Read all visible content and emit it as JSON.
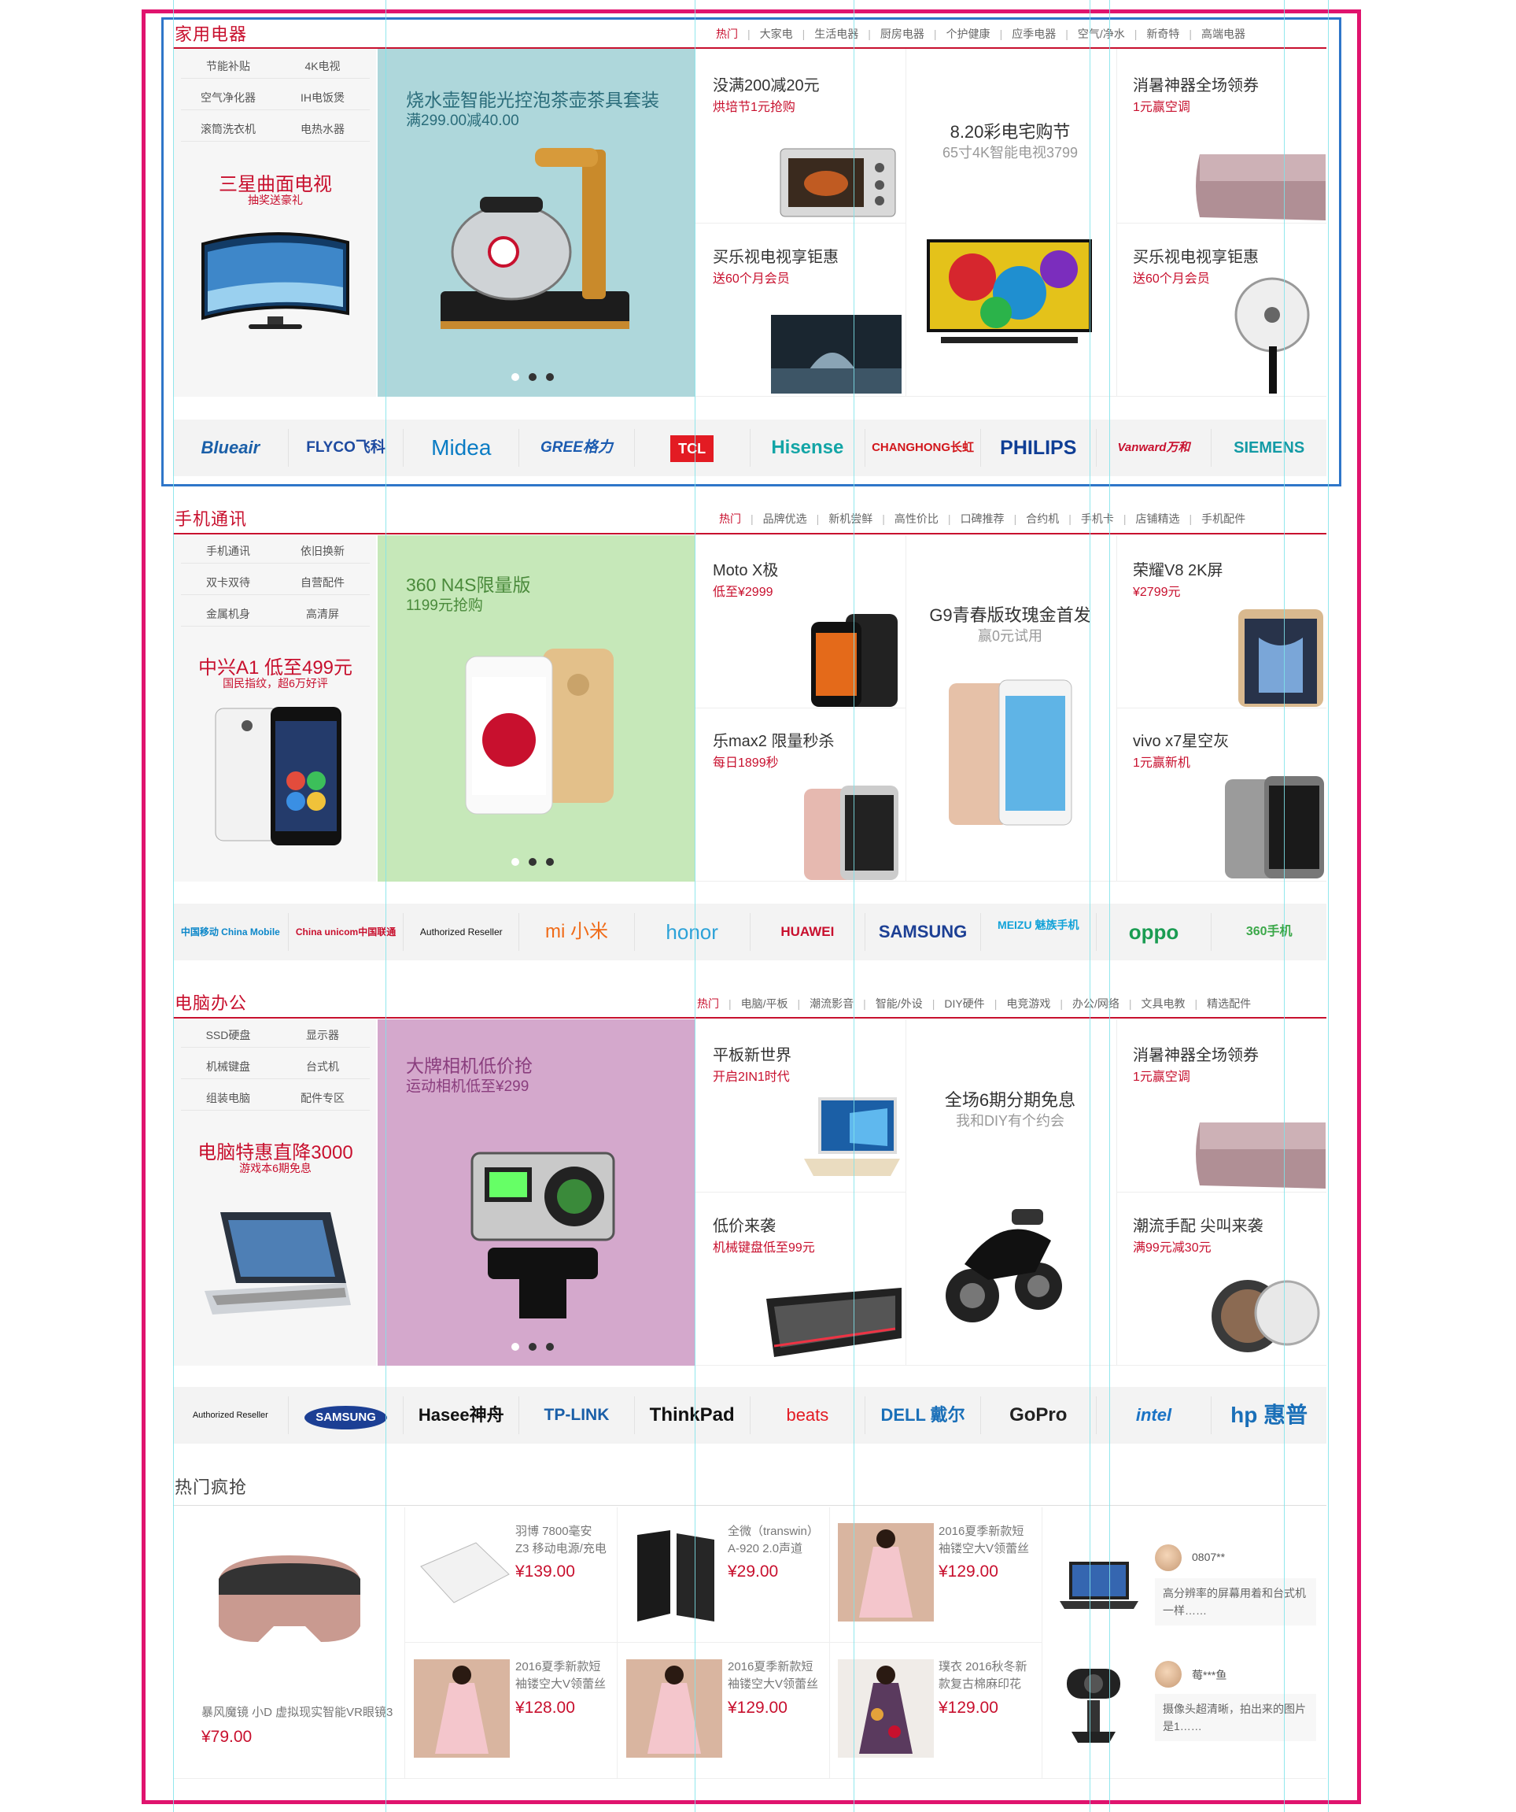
{
  "sections": [
    {
      "title": "家用电器",
      "nav": [
        "热门",
        "大家电",
        "生活电器",
        "厨房电器",
        "个护健康",
        "应季电器",
        "空气/净水",
        "新奇特",
        "高端电器"
      ],
      "tags": [
        "节能补贴",
        "4K电视",
        "空气净化器",
        "IH电饭煲",
        "滚筒洗衣机",
        "电热水器"
      ],
      "left_title": "三星曲面电视",
      "left_sub": "抽奖送豪礼",
      "banner_title": "烧水壶智能光控泡茶壶茶具套装",
      "banner_sub": "满299.00减40.00",
      "cells": [
        {
          "title": "没满200减20元",
          "sub": "烘培节1元抢购"
        },
        {
          "title": "8.20彩电宅购节",
          "sub": "65寸4K智能电视3799"
        },
        {
          "title": "消暑神器全场领券",
          "sub": "1元赢空调"
        },
        {
          "title": "买乐视电视享钜惠",
          "sub": "送60个月会员"
        },
        {
          "title": "买乐视电视享钜惠",
          "sub": "送60个月会员"
        }
      ],
      "brands": [
        "Blueair",
        "FLYCO飞科",
        "Midea",
        "GREE格力",
        "TCL",
        "Hisense",
        "CHANGHONG长虹",
        "PHILIPS",
        "Vanward万和",
        "SIEMENS"
      ]
    },
    {
      "title": "手机通讯",
      "nav": [
        "热门",
        "品牌优选",
        "新机尝鲜",
        "高性价比",
        "口碑推荐",
        "合约机",
        "手机卡",
        "店铺精选",
        "手机配件"
      ],
      "tags": [
        "手机通讯",
        "依旧换新",
        "双卡双待",
        "自营配件",
        "金属机身",
        "高清屏"
      ],
      "left_title": "中兴A1 低至499元",
      "left_sub": "国民指纹，超6万好评",
      "banner_title": "360 N4S限量版",
      "banner_sub": "1199元抢购",
      "cells": [
        {
          "title": "Moto X极",
          "sub": "低至¥2999"
        },
        {
          "title": "G9青春版玫瑰金首发",
          "sub": "赢0元试用"
        },
        {
          "title": "荣耀V8 2K屏",
          "sub": "¥2799元"
        },
        {
          "title": "乐max2 限量秒杀",
          "sub": "每日1899秒"
        },
        {
          "title": "vivo x7星空灰",
          "sub": "1元赢新机"
        }
      ],
      "brands": [
        "中国移动 China Mobile",
        "China unicom中国联通",
        "Authorized Reseller",
        "mi 小米",
        "honor",
        "HUAWEI",
        "SAMSUNG",
        "MEIZU 魅族手机",
        "oppo",
        "360手机"
      ]
    },
    {
      "title": "电脑办公",
      "nav": [
        "热门",
        "电脑/平板",
        "潮流影音",
        "智能/外设",
        "DIY硬件",
        "电竞游戏",
        "办公/网络",
        "文具电教",
        "精选配件"
      ],
      "tags": [
        "SSD硬盘",
        "显示器",
        "机械键盘",
        "台式机",
        "组装电脑",
        "配件专区"
      ],
      "left_title": "电脑特惠直降3000",
      "left_sub": "游戏本6期免息",
      "banner_title": "大牌相机低价抢",
      "banner_sub": "运动相机低至¥299",
      "cells": [
        {
          "title": "平板新世界",
          "sub": "开启2IN1时代"
        },
        {
          "title": "全场6期分期免息",
          "sub": "我和DIY有个约会"
        },
        {
          "title": "消暑神器全场领券",
          "sub": "1元赢空调"
        },
        {
          "title": "低价来袭",
          "sub": "机械键盘低至99元"
        },
        {
          "title": "潮流手配 尖叫来袭",
          "sub": "满99元减30元"
        }
      ],
      "brands": [
        "Authorized Reseller",
        "SAMSUNG",
        "Hasee神舟",
        "TP-LINK",
        "ThinkPad",
        "beats",
        "DELL 戴尔",
        "GoPro",
        "intel",
        "hp 惠普"
      ]
    }
  ],
  "hot": {
    "title": "热门疯抢",
    "featured": {
      "name": "暴风魔镜 小D 虚拟现实智能VR眼镜3",
      "price": "¥79.00"
    },
    "items": [
      {
        "name": "羽博 7800毫安 Z3 移动电源/充电",
        "price": "¥139.00"
      },
      {
        "name": "全微（transwin）A-920 2.0声道",
        "price": "¥29.00"
      },
      {
        "name": "2016夏季新款短袖镂空大V领蕾丝",
        "price": "¥129.00"
      },
      {
        "name": "2016夏季新款短袖镂空大V领蕾丝",
        "price": "¥128.00"
      },
      {
        "name": "2016夏季新款短袖镂空大V领蕾丝",
        "price": "¥129.00"
      },
      {
        "name": "璞衣 2016秋冬新款复古棉麻印花",
        "price": "¥129.00"
      }
    ],
    "reviews": [
      {
        "user": "0807**",
        "text": "高分辨率的屏幕用着和台式机一样……"
      },
      {
        "user": "莓***鱼",
        "text": "摄像头超清晰，拍出来的图片是1……"
      }
    ]
  },
  "colors": {
    "accent": "#c8102e",
    "banner1": "#aed7db",
    "banner2": "#c6e8b9",
    "banner3": "#d4a8cc",
    "frame": "#e0136e",
    "guide": "#7fe3ea"
  }
}
